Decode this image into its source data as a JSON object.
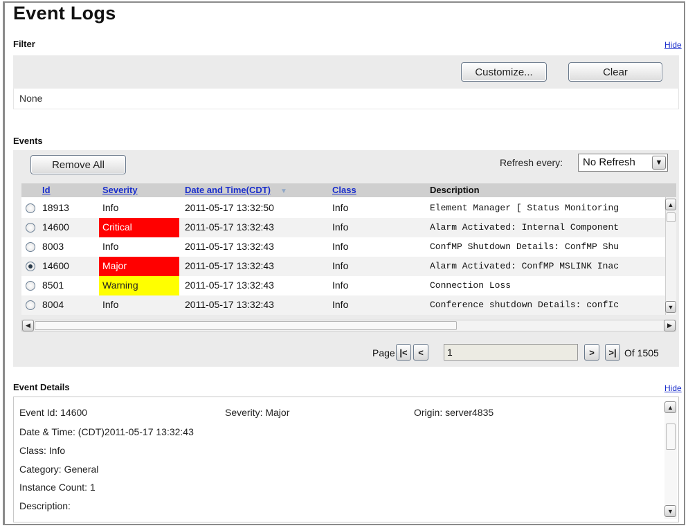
{
  "page": {
    "title": "Event Logs"
  },
  "filter": {
    "title": "Filter",
    "hide_label": "Hide",
    "customize_label": "Customize...",
    "clear_label": "Clear",
    "value": "None"
  },
  "events": {
    "title": "Events",
    "remove_all_label": "Remove All",
    "refresh_label": "Refresh every:",
    "refresh_value": "No Refresh",
    "columns": [
      "Id",
      "Severity",
      "Date and Time(CDT)",
      "Class",
      "Description"
    ],
    "rows": [
      {
        "id": "18913",
        "severity": "Info",
        "datetime": "2011-05-17 13:32:50",
        "class": "Info",
        "description": "Element Manager [ Status Monitoring",
        "selected": false
      },
      {
        "id": "14600",
        "severity": "Critical",
        "datetime": "2011-05-17 13:32:43",
        "class": "Info",
        "description": "Alarm Activated: Internal Component",
        "selected": false
      },
      {
        "id": "8003",
        "severity": "Info",
        "datetime": "2011-05-17 13:32:43",
        "class": "Info",
        "description": "ConfMP Shutdown Details: ConfMP Shu",
        "selected": false
      },
      {
        "id": "14600",
        "severity": "Major",
        "datetime": "2011-05-17 13:32:43",
        "class": "Info",
        "description": "Alarm Activated: ConfMP MSLINK Inac",
        "selected": true
      },
      {
        "id": "8501",
        "severity": "Warning",
        "datetime": "2011-05-17 13:32:43",
        "class": "Info",
        "description": "Connection Loss",
        "selected": false
      },
      {
        "id": "8004",
        "severity": "Info",
        "datetime": "2011-05-17 13:32:43",
        "class": "Info",
        "description": "Conference shutdown Details: confIc",
        "selected": false
      }
    ],
    "severity_colors": {
      "Critical": "#ff0000",
      "Major": "#ff0000",
      "Warning": "#ffff00"
    },
    "severity_text_colors": {
      "Critical": "#ffffff",
      "Major": "#ffffff",
      "Warning": "#222222"
    },
    "pager": {
      "label": "Page:",
      "first": "|<",
      "prev": "<",
      "current": "1",
      "next": ">",
      "last": ">|",
      "of_text": "Of 1505"
    }
  },
  "details": {
    "title": "Event Details",
    "hide_label": "Hide",
    "event_id": "Event Id: 14600",
    "severity": "Severity: Major",
    "origin": "Origin: server4835",
    "datetime": "Date & Time: (CDT)2011-05-17 13:32:43",
    "class": "Class: Info",
    "category": "Category: General",
    "instance_count": "Instance Count: 1",
    "description": "Description:"
  }
}
